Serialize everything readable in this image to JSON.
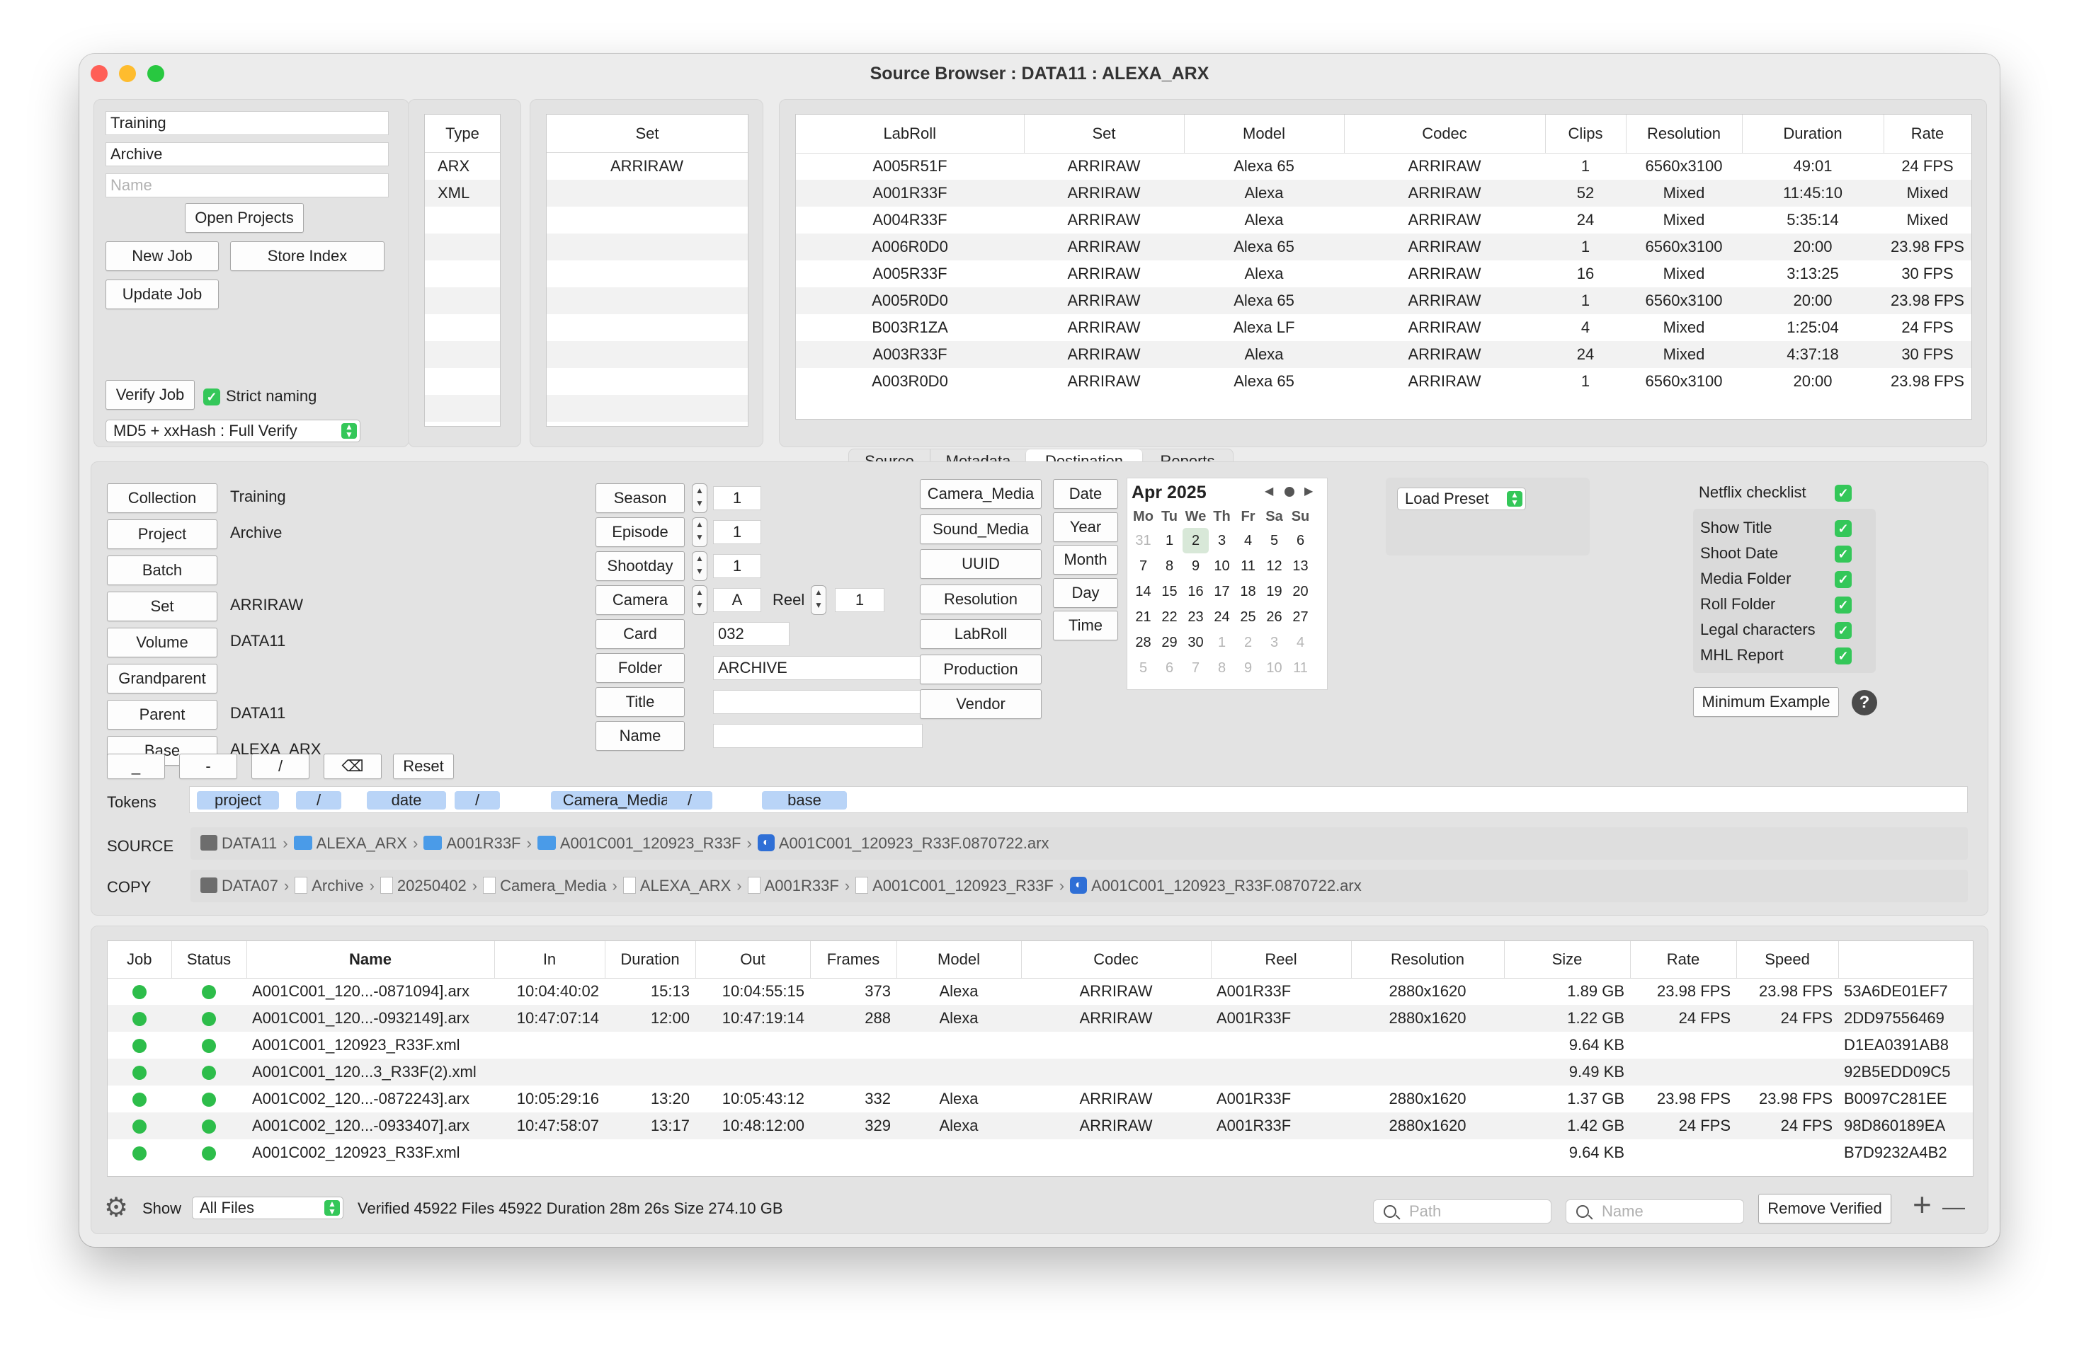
{
  "window": {
    "title": "Source Browser : DATA11 : ALEXA_ARX"
  },
  "project_panel": {
    "field1": "Training",
    "field2": "Archive",
    "name_placeholder": "Name",
    "open_projects": "Open Projects",
    "new_job": "New Job",
    "store_index": "Store Index",
    "update_job": "Update Job",
    "verify_job": "Verify Job",
    "strict_naming": "Strict naming",
    "verify_mode": "MD5 + xxHash : Full Verify"
  },
  "type_list": {
    "header": "Type",
    "items": [
      "ARX",
      "XML"
    ]
  },
  "set_list": {
    "header": "Set",
    "items": [
      "ARRIRAW"
    ]
  },
  "labroll_table": {
    "columns": [
      "LabRoll",
      "Set",
      "Model",
      "Codec",
      "Clips",
      "Resolution",
      "Duration",
      "Rate"
    ],
    "rows": [
      [
        "A005R51F",
        "ARRIRAW",
        "Alexa 65",
        "ARRIRAW",
        "1",
        "6560x3100",
        "49:01",
        "24 FPS"
      ],
      [
        "A001R33F",
        "ARRIRAW",
        "Alexa",
        "ARRIRAW",
        "52",
        "Mixed",
        "11:45:10",
        "Mixed"
      ],
      [
        "A004R33F",
        "ARRIRAW",
        "Alexa",
        "ARRIRAW",
        "24",
        "Mixed",
        "5:35:14",
        "Mixed"
      ],
      [
        "A006R0D0",
        "ARRIRAW",
        "Alexa 65",
        "ARRIRAW",
        "1",
        "6560x3100",
        "20:00",
        "23.98 FPS"
      ],
      [
        "A005R33F",
        "ARRIRAW",
        "Alexa",
        "ARRIRAW",
        "16",
        "Mixed",
        "3:13:25",
        "30 FPS"
      ],
      [
        "A005R0D0",
        "ARRIRAW",
        "Alexa 65",
        "ARRIRAW",
        "1",
        "6560x3100",
        "20:00",
        "23.98 FPS"
      ],
      [
        "B003R1ZA",
        "ARRIRAW",
        "Alexa LF",
        "ARRIRAW",
        "4",
        "Mixed",
        "1:25:04",
        "24 FPS"
      ],
      [
        "A003R33F",
        "ARRIRAW",
        "Alexa",
        "ARRIRAW",
        "24",
        "Mixed",
        "4:37:18",
        "30 FPS"
      ],
      [
        "A003R0D0",
        "ARRIRAW",
        "Alexa 65",
        "ARRIRAW",
        "1",
        "6560x3100",
        "20:00",
        "23.98 FPS"
      ]
    ]
  },
  "tabs": {
    "source": "Source",
    "metadata": "Metadata",
    "destination": "Destination",
    "reports": "Reports"
  },
  "destination": {
    "left": [
      {
        "button": "Collection",
        "value": "Training"
      },
      {
        "button": "Project",
        "value": "Archive"
      },
      {
        "button": "Batch",
        "value": ""
      },
      {
        "button": "Set",
        "value": "ARRIRAW"
      },
      {
        "button": "Volume",
        "value": "DATA11"
      },
      {
        "button": "Grandparent",
        "value": ""
      },
      {
        "button": "Parent",
        "value": "DATA11"
      },
      {
        "button": "Base",
        "value": "ALEXA_ARX"
      }
    ],
    "season": {
      "label": "Season",
      "value": "1"
    },
    "episode": {
      "label": "Episode",
      "value": "1"
    },
    "shootday": {
      "label": "Shootday",
      "value": "1"
    },
    "camera": {
      "label": "Camera",
      "value": "A"
    },
    "reel": {
      "label": "Reel",
      "value": "1"
    },
    "card": {
      "label": "Card",
      "value": "032"
    },
    "folder": {
      "label": "Folder",
      "value": "ARCHIVE"
    },
    "title": {
      "label": "Title",
      "value": ""
    },
    "name": {
      "label": "Name",
      "value": ""
    },
    "tag_buttons": [
      "Camera_Media",
      "Sound_Media",
      "UUID",
      "Resolution",
      "LabRoll",
      "Production",
      "Vendor"
    ],
    "date_buttons": [
      "Date",
      "Year",
      "Month",
      "Day",
      "Time"
    ],
    "calendar": {
      "month": "Apr 2025",
      "days": [
        "Mo",
        "Tu",
        "We",
        "Th",
        "Fr",
        "Sa",
        "Su"
      ],
      "weeks": [
        [
          "31",
          "1",
          "2",
          "3",
          "4",
          "5",
          "6"
        ],
        [
          "7",
          "8",
          "9",
          "10",
          "11",
          "12",
          "13"
        ],
        [
          "14",
          "15",
          "16",
          "17",
          "18",
          "19",
          "20"
        ],
        [
          "21",
          "22",
          "23",
          "24",
          "25",
          "26",
          "27"
        ],
        [
          "28",
          "29",
          "30",
          "1",
          "2",
          "3",
          "4"
        ],
        [
          "5",
          "6",
          "7",
          "8",
          "9",
          "10",
          "11"
        ]
      ]
    },
    "load_preset": "Load Preset",
    "netflix_checklist": "Netflix checklist",
    "checklist": [
      "Show Title",
      "Shoot Date",
      "Media Folder",
      "Roll Folder",
      "Legal characters",
      "MHL Report"
    ],
    "minimum_example": "Minimum Example",
    "help": "?",
    "sep_buttons": [
      "_",
      "-",
      "/",
      "⌫"
    ],
    "reset": "Reset",
    "tokens_label": "Tokens",
    "tokens": [
      "project",
      "/",
      "date",
      "/",
      "Camera_Media",
      "/",
      "base"
    ],
    "source_label": "SOURCE",
    "source_path": [
      "DATA11",
      "ALEXA_ARX",
      "A001R33F",
      "A001C001_120923_R33F",
      "A001C001_120923_R33F.0870722.arx"
    ],
    "copy_label": "COPY",
    "copy_path": [
      "DATA07",
      "Archive",
      "20250402",
      "Camera_Media",
      "ALEXA_ARX",
      "A001R33F",
      "A001C001_120923_R33F",
      "A001C001_120923_R33F.0870722.arx"
    ]
  },
  "job_table": {
    "columns": [
      "Job",
      "Status",
      "Name",
      "In",
      "Duration",
      "Out",
      "Frames",
      "Model",
      "Codec",
      "Reel",
      "Resolution",
      "Size",
      "Rate",
      "Speed",
      ""
    ],
    "rows": [
      [
        "A001C001_120...-0871094].arx",
        "10:04:40:02",
        "15:13",
        "10:04:55:15",
        "373",
        "Alexa",
        "ARRIRAW",
        "A001R33F",
        "2880x1620",
        "1.89 GB",
        "23.98 FPS",
        "23.98 FPS",
        "53A6DE01EF7"
      ],
      [
        "A001C001_120...-0932149].arx",
        "10:47:07:14",
        "12:00",
        "10:47:19:14",
        "288",
        "Alexa",
        "ARRIRAW",
        "A001R33F",
        "2880x1620",
        "1.22 GB",
        "24 FPS",
        "24 FPS",
        "2DD97556469"
      ],
      [
        "A001C001_120923_R33F.xml",
        "",
        "",
        "",
        "",
        "",
        "",
        "",
        "",
        "9.64 KB",
        "",
        "",
        "D1EA0391AB8"
      ],
      [
        "A001C001_120...3_R33F(2).xml",
        "",
        "",
        "",
        "",
        "",
        "",
        "",
        "",
        "9.49 KB",
        "",
        "",
        "92B5EDD09C5"
      ],
      [
        "A001C002_120...-0872243].arx",
        "10:05:29:16",
        "13:20",
        "10:05:43:12",
        "332",
        "Alexa",
        "ARRIRAW",
        "A001R33F",
        "2880x1620",
        "1.37 GB",
        "23.98 FPS",
        "23.98 FPS",
        "B0097C281EE"
      ],
      [
        "A001C002_120...-0933407].arx",
        "10:47:58:07",
        "13:17",
        "10:48:12:00",
        "329",
        "Alexa",
        "ARRIRAW",
        "A001R33F",
        "2880x1620",
        "1.42 GB",
        "24 FPS",
        "24 FPS",
        "98D860189EA"
      ],
      [
        "A001C002_120923_R33F.xml",
        "",
        "",
        "",
        "",
        "",
        "",
        "",
        "",
        "9.64 KB",
        "",
        "",
        "B7D9232A4B2"
      ]
    ]
  },
  "footer": {
    "show_label": "Show",
    "show_value": "All Files",
    "status": "Verified 45922 Files 45922 Duration 28m 26s Size 274.10 GB",
    "path_placeholder": "Path",
    "name_placeholder": "Name",
    "remove_verified": "Remove Verified",
    "plus": "+",
    "minus": "—"
  },
  "colors": {
    "accent": "#34c759",
    "token": "#b9d4f7",
    "folder": "#4a9be8"
  }
}
